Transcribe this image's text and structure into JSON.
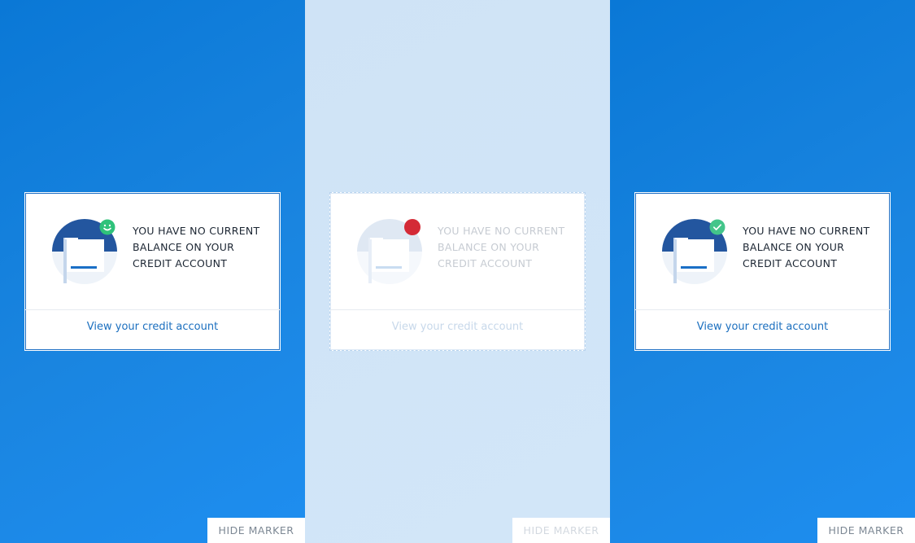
{
  "panels": [
    {
      "variant": "active",
      "status_icon": "smiley-face-icon",
      "status_color": "#2fc27a",
      "message": "YOU HAVE NO CURRENT BALANCE ON YOUR CREDIT ACCOUNT",
      "link_label": "View your credit account",
      "hide_label": "HIDE MARKER"
    },
    {
      "variant": "disabled",
      "status_icon": "red-dot-icon",
      "status_color": "#d42a36",
      "message": "YOU HAVE NO CURRENT BALANCE ON YOUR CREDIT ACCOUNT",
      "link_label": "View your credit account",
      "hide_label": "HIDE MARKER"
    },
    {
      "variant": "active",
      "status_icon": "checkmark-icon",
      "status_color": "#43c58a",
      "message": "YOU HAVE NO CURRENT BALANCE ON YOUR CREDIT ACCOUNT",
      "link_label": "View your credit account",
      "hide_label": "HIDE MARKER"
    }
  ],
  "colors": {
    "brand_blue": "#1a85e0",
    "link_blue": "#1b6fbf",
    "illustration_navy": "#23569f"
  }
}
